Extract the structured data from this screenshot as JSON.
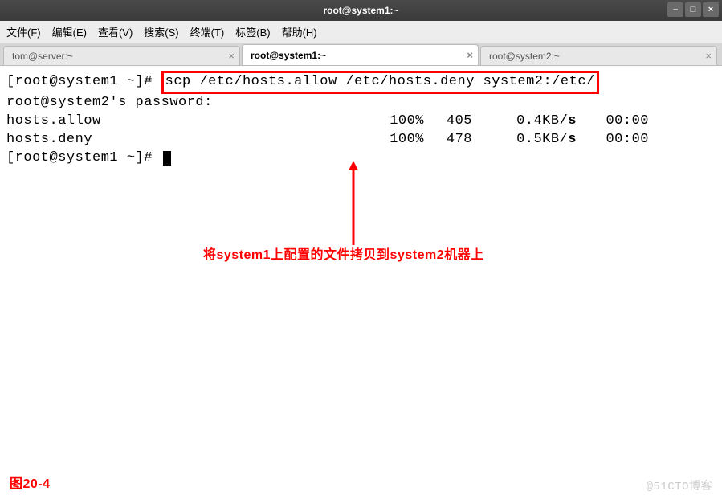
{
  "titlebar": {
    "title": "root@system1:~"
  },
  "menubar": {
    "file": "文件(F)",
    "edit": "编辑(E)",
    "view": "查看(V)",
    "search": "搜索(S)",
    "terminal": "终端(T)",
    "tabs": "标签(B)",
    "help": "帮助(H)"
  },
  "tabs": [
    {
      "label": "tom@server:~"
    },
    {
      "label": "root@system1:~"
    },
    {
      "label": "root@system2:~"
    }
  ],
  "term": {
    "prompt1": "[root@system1 ~]# ",
    "scp_command": "scp /etc/hosts.allow /etc/hosts.deny system2:/etc/",
    "password_prompt": "root@system2's password:",
    "files": [
      {
        "name": "hosts.allow",
        "pct": "100%",
        "size": "405",
        "rate": "0.4KB/s",
        "time": "00:00"
      },
      {
        "name": "hosts.deny",
        "pct": "100%",
        "size": "478",
        "rate": "0.5KB/s",
        "time": "00:00"
      }
    ],
    "prompt2": "[root@system1 ~]# "
  },
  "annotation": "将system1上配置的文件拷贝到system2机器上",
  "figure_label": "图20-4",
  "watermark": "@51CTO博客"
}
